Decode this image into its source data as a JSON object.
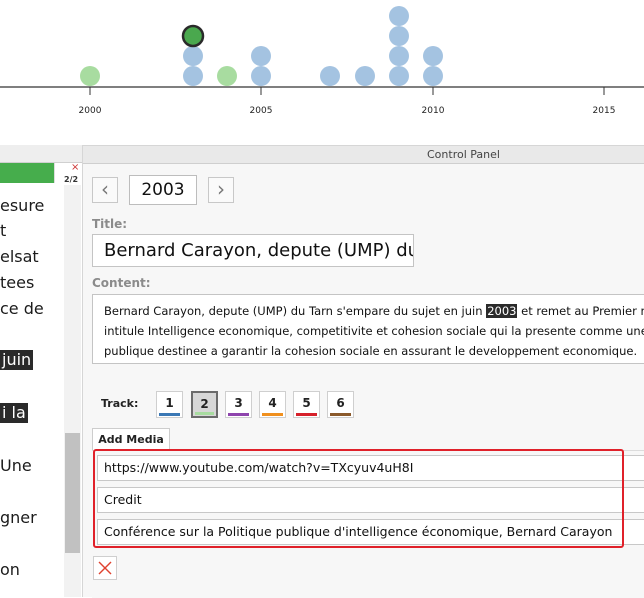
{
  "timeline": {
    "tick_labels": [
      "2000",
      "2005",
      "2010",
      "2015"
    ],
    "colors": {
      "blue": "#a4c3e1",
      "green": "#a8dca0",
      "selected": "#4aa84e"
    }
  },
  "sidebar": {
    "counter": "2/2",
    "close_glyph": "×",
    "fragments": [
      "esure",
      "t",
      "elsat",
      "tees",
      "ce de",
      "juin",
      "i la",
      "Une",
      "gner",
      "on"
    ]
  },
  "panel": {
    "title": "Control Panel",
    "nav_prev": "‹",
    "nav_next": "›",
    "year": "2003",
    "title_label": "Title:",
    "title_value": "Bernard Carayon, depute (UMP) du",
    "content_label": "Content:",
    "content_lines": {
      "l1_pre": "Bernard Carayon, depute (UMP) du Tarn s'empare du sujet en juin ",
      "l1_hl": "2003",
      "l1_post": " et remet au Premier ministre un rapport",
      "l2": "intitule Intelligence economique, competitivite et cohesion sociale qui la presente comme une politique",
      "l3": "publique destinee a garantir la cohesion sociale en assurant le developpement economique."
    },
    "track_label": "Track:",
    "tracks": [
      {
        "label": "1",
        "color": "#3b78b5",
        "selected": false
      },
      {
        "label": "2",
        "color": "#a8dca0",
        "selected": true
      },
      {
        "label": "3",
        "color": "#8e44ad",
        "selected": false
      },
      {
        "label": "4",
        "color": "#f0901e",
        "selected": false
      },
      {
        "label": "5",
        "color": "#d6202a",
        "selected": false
      },
      {
        "label": "6",
        "color": "#8b5a2b",
        "selected": false
      }
    ],
    "add_media_label": "Add Media",
    "media": {
      "url": "https://www.youtube.com/watch?v=TXcyuv4uH8I",
      "credit": "Credit",
      "caption": "Conférence sur la Politique publique d'intelligence économique, Bernard Carayon"
    }
  }
}
